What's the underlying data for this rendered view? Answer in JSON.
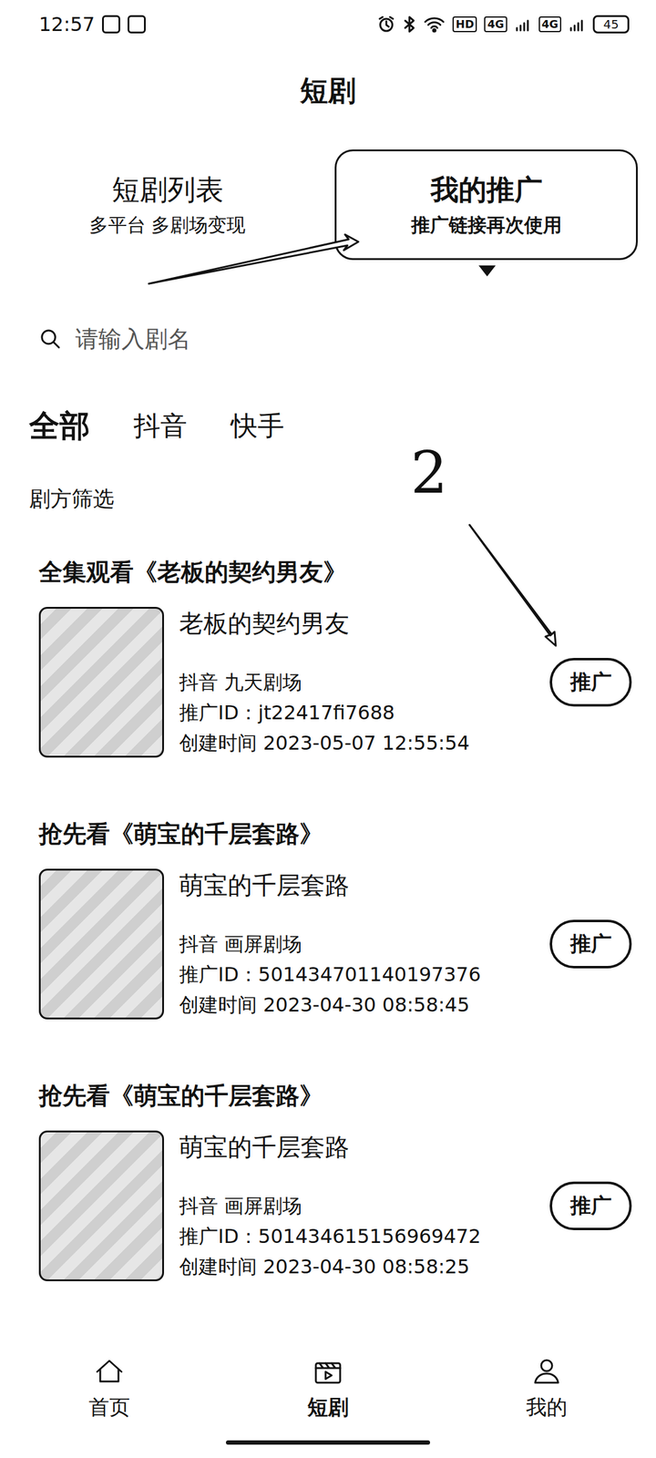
{
  "status_bar": {
    "time": "12:57",
    "network_labels": [
      "HD",
      "4G",
      "4G"
    ],
    "battery": "45"
  },
  "title": "短剧",
  "header_tabs": [
    {
      "label": "短剧列表",
      "subtitle": "多平台 多剧场变现",
      "selected": false
    },
    {
      "label": "我的推广",
      "subtitle": "推广链接再次使用",
      "selected": true
    }
  ],
  "search": {
    "placeholder": "请输入剧名"
  },
  "platform_tabs": [
    {
      "label": "全部",
      "selected": true
    },
    {
      "label": "抖音",
      "selected": false
    },
    {
      "label": "快手",
      "selected": false
    }
  ],
  "filter_label": "剧方筛选",
  "dramas": [
    {
      "heading": "全集观看《老板的契约男友》",
      "title": "老板的契约男友",
      "platform": "抖音 九天剧场",
      "promo_id": "推广ID：jt22417fi7688",
      "created": "创建时间 2023-05-07 12:55:54",
      "button": "推广"
    },
    {
      "heading": "抢先看《萌宝的千层套路》",
      "title": "萌宝的千层套路",
      "platform": "抖音 画屏剧场",
      "promo_id": "推广ID：501434701140197376",
      "created": "创建时间 2023-04-30 08:58:45",
      "button": "推广"
    },
    {
      "heading": "抢先看《萌宝的千层套路》",
      "title": "萌宝的千层套路",
      "platform": "抖音 画屏剧场",
      "promo_id": "推广ID：501434615156969472",
      "created": "创建时间 2023-04-30 08:58:25",
      "button": "推广"
    }
  ],
  "annotation": {
    "step_label": "2"
  },
  "bottom_nav": [
    {
      "label": "首页",
      "selected": false
    },
    {
      "label": "短剧",
      "selected": true
    },
    {
      "label": "我的",
      "selected": false
    }
  ]
}
